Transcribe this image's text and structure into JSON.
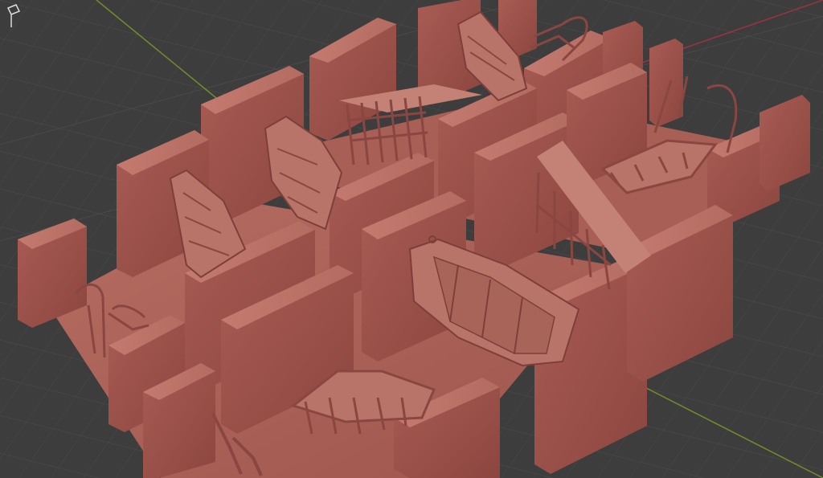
{
  "viewport": {
    "background": "#3d3d3d",
    "grid_color": "#4a4a4a",
    "x_axis_color": "#9b3340",
    "y_axis_color": "#6f8f2a",
    "material_color": "#a65a52"
  },
  "scene": {
    "objects": [
      "wall-block",
      "support-lattice",
      "panel-part",
      "hull-part",
      "frame-part"
    ]
  }
}
